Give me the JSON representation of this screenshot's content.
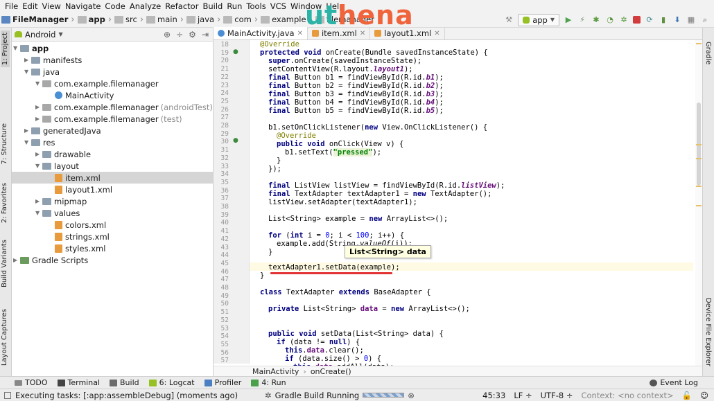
{
  "menu": [
    "File",
    "Edit",
    "View",
    "Navigate",
    "Code",
    "Analyze",
    "Refactor",
    "Build",
    "Run",
    "Tools",
    "VCS",
    "Window",
    "Help"
  ],
  "watermark": {
    "part1": "ut",
    "part2": "hena"
  },
  "nav": {
    "crumbs": [
      "FileManager",
      "app",
      "src",
      "main",
      "java",
      "com",
      "example",
      "filemanager"
    ],
    "run_config": "app"
  },
  "left_tabs": {
    "project": "1: Project",
    "structure": "7: Structure",
    "favorites": "2: Favorites",
    "build_variants": "Build Variants",
    "layout_captures": "Layout Captures"
  },
  "right_tabs": {
    "gradle": "Gradle",
    "device_explorer": "Device File Explorer"
  },
  "project": {
    "view": "Android",
    "tree": [
      {
        "label": "app",
        "extra": ""
      },
      {
        "label": "manifests",
        "extra": ""
      },
      {
        "label": "java",
        "extra": ""
      },
      {
        "label": "com.example.filemanager",
        "extra": ""
      },
      {
        "label": "MainActivity",
        "extra": ""
      },
      {
        "label": "com.example.filemanager",
        "extra": "(androidTest)"
      },
      {
        "label": "com.example.filemanager",
        "extra": "(test)"
      },
      {
        "label": "generatedJava",
        "extra": ""
      },
      {
        "label": "res",
        "extra": ""
      },
      {
        "label": "drawable",
        "extra": ""
      },
      {
        "label": "layout",
        "extra": ""
      },
      {
        "label": "item.xml",
        "extra": ""
      },
      {
        "label": "layout1.xml",
        "extra": ""
      },
      {
        "label": "mipmap",
        "extra": ""
      },
      {
        "label": "values",
        "extra": ""
      },
      {
        "label": "colors.xml",
        "extra": ""
      },
      {
        "label": "strings.xml",
        "extra": ""
      },
      {
        "label": "styles.xml",
        "extra": ""
      },
      {
        "label": "Gradle Scripts",
        "extra": ""
      }
    ]
  },
  "editor": {
    "tabs": [
      "MainActivity.java",
      "item.xml",
      "layout1.xml"
    ],
    "line_numbers": [
      "18",
      "19",
      "20",
      "21",
      "22",
      "23",
      "24",
      "25",
      "26",
      "27",
      "28",
      "29",
      "30",
      "31",
      "32",
      "33",
      "34",
      "35",
      "36",
      "37",
      "38",
      "39",
      "40",
      "41",
      "42",
      "43",
      "44",
      "45",
      "46",
      "47",
      "48",
      "49",
      "50",
      "51",
      "52",
      "53",
      "54",
      "55",
      "56",
      "57"
    ],
    "tooltip": "List<String> data",
    "breadcrumb": [
      "MainActivity",
      "onCreate()"
    ]
  },
  "bottom_tools": [
    "TODO",
    "Terminal",
    "Build",
    "6: Logcat",
    "Profiler",
    "4: Run",
    "Event Log"
  ],
  "status": {
    "left": "Executing tasks: [:app:assembleDebug] (moments ago)",
    "center": "Gradle Build Running",
    "position": "45:33",
    "line_sep": "LF",
    "encoding": "UTF-8",
    "context": "Context: <no context>"
  }
}
